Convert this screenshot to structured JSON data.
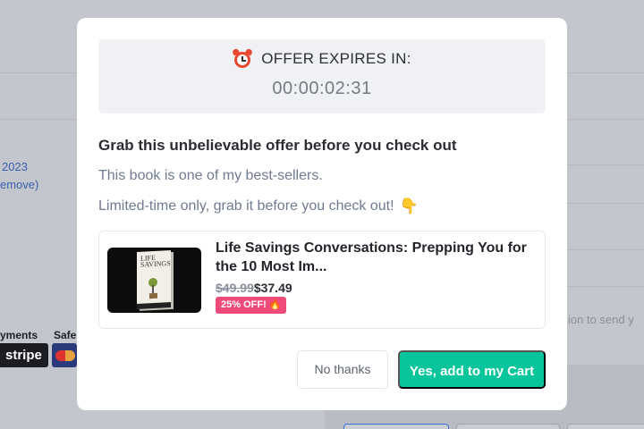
{
  "background": {
    "date_fragment": "2023",
    "remove_link": "emove)",
    "payments_label": "yments",
    "safe_label": "Safe",
    "stripe_label": "stripe",
    "session_fragment": "ssion to send y"
  },
  "modal": {
    "timer": {
      "title": "OFFER EXPIRES IN:",
      "value": "00:00:02:31",
      "icon": "alarm-clock-icon"
    },
    "heading": "Grab this unbelievable offer before you check out",
    "subtext1": "This book is one of my best-sellers.",
    "subtext2": "Limited-time only, grab it before you check out!",
    "subtext2_icon": "pointing-down-hand-icon",
    "product": {
      "title": "Life Savings Conversations: Prepping You for the 10 Most Im...",
      "old_price": "$49.99",
      "new_price": "$37.49",
      "discount_badge": "25% OFF! 🔥",
      "cover_text": "LIFE SAVINGS"
    },
    "buttons": {
      "decline": "No thanks",
      "accept": "Yes, add to my Cart"
    }
  },
  "colors": {
    "accent": "#08c59c",
    "badge": "#ee4b7a",
    "overlay": "#c4c6cd"
  }
}
